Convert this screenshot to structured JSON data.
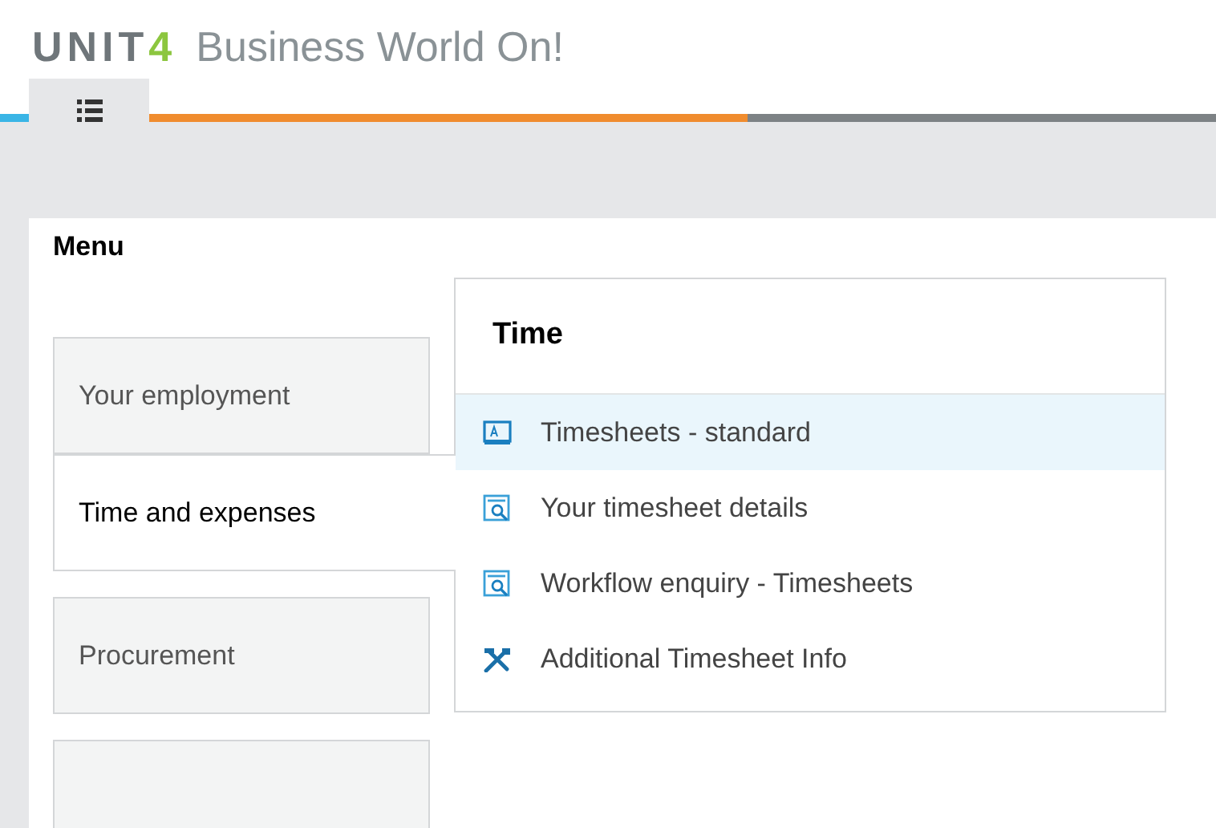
{
  "logo": {
    "text": "UNIT",
    "accent": "4"
  },
  "product": "Business World On!",
  "menu": {
    "title": "Menu",
    "items": [
      {
        "label": "Your employment",
        "selected": false
      },
      {
        "label": "Time and expenses",
        "selected": true
      },
      {
        "label": "Procurement",
        "selected": false
      }
    ]
  },
  "submenu": {
    "title": "Time",
    "items": [
      {
        "label": "Timesheets - standard",
        "kind": "form",
        "selected": true
      },
      {
        "label": "Your timesheet details",
        "kind": "enquiry",
        "selected": false
      },
      {
        "label": "Workflow enquiry - Timesheets",
        "kind": "enquiry",
        "selected": false
      },
      {
        "label": "Additional Timesheet Info",
        "kind": "tool",
        "selected": false
      }
    ]
  }
}
